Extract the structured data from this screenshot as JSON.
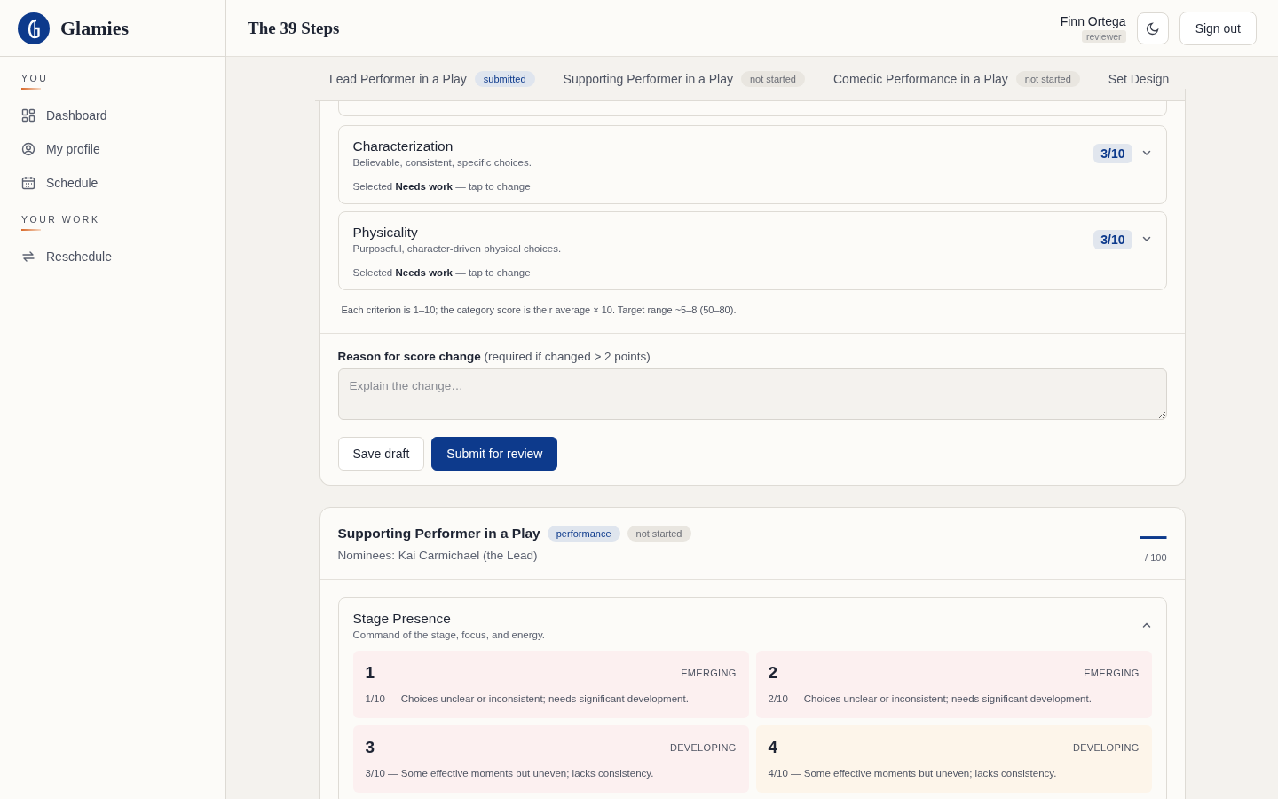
{
  "brand": {
    "name": "Glamies"
  },
  "sidebar": {
    "sections": [
      {
        "heading": "YOU",
        "items": [
          {
            "label": "Dashboard"
          },
          {
            "label": "My profile"
          },
          {
            "label": "Schedule"
          }
        ]
      },
      {
        "heading": "YOUR WORK",
        "items": [
          {
            "label": "Reschedule"
          }
        ]
      }
    ]
  },
  "header": {
    "title": "The 39 Steps",
    "user": {
      "name": "Finn Ortega",
      "role": "reviewer"
    },
    "sign_out": "Sign out"
  },
  "tabs": [
    {
      "label": "Lead Performer in a Play",
      "status": "submitted",
      "kind": "done",
      "selected": false
    },
    {
      "label": "Supporting Performer in a Play",
      "status": "not started",
      "kind": "todo",
      "selected": false
    },
    {
      "label": "Comedic Performance in a Play",
      "status": "not started",
      "kind": "todo",
      "selected": false
    },
    {
      "label": "Set Design",
      "selected": false
    }
  ],
  "panels": [
    {
      "criteria": [
        {
          "kind": "hidden"
        },
        {
          "kind": "criterion",
          "name": "Characterization",
          "description": "Believable, consistent, specific choices.",
          "score": "3/10",
          "selection": "Selected **Needs work** — tap to change",
          "expanded": false
        },
        {
          "kind": "criterion",
          "name": "Physicality",
          "description": "Purposeful, character-driven physical choices.",
          "score": "3/10",
          "selection": "Selected **Needs work** — tap to change",
          "expanded": false
        }
      ],
      "note": "Each criterion is 1–10; the category score is their average × 10. Target range ~5–8 (50–80).",
      "reason": {
        "label": "**Reason for score change** (required if changed > 2 points)",
        "placeholder": "Explain the change…"
      },
      "buttons": [
        {
          "label": "Save draft",
          "kind": "secondary"
        },
        {
          "label": "Submit for review",
          "kind": "primary"
        }
      ]
    },
    {
      "title": "Supporting Performer in a Play",
      "tags": [
        {
          "label": "performance",
          "kind": "type"
        },
        {
          "label": "not started",
          "kind": "status"
        }
      ],
      "nominees": "Nominees: Kai Carmichael (the Lead)",
      "score": "—",
      "score_max": "/ 100",
      "criteria": [
        {
          "kind": "criterion",
          "name": "Stage Presence",
          "description": "Command of the stage, focus, and energy.",
          "expanded": true,
          "options": [
            {
              "value": "1",
              "band": "EMERGING",
              "text": "1/10 — Choices unclear or inconsistent; needs significant development.",
              "color": "#fcf0f0"
            },
            {
              "value": "2",
              "band": "EMERGING",
              "text": "2/10 — Choices unclear or inconsistent; needs significant development.",
              "color": "#fcf0f0"
            },
            {
              "value": "3",
              "band": "DEVELOPING",
              "text": "3/10 — Some effective moments but uneven; lacks consistency.",
              "color": "#fcf0f0"
            },
            {
              "value": "4",
              "band": "DEVELOPING",
              "text": "4/10 — Some effective moments but uneven; lacks consistency.",
              "color": "#fdf5ea"
            }
          ]
        }
      ]
    }
  ]
}
